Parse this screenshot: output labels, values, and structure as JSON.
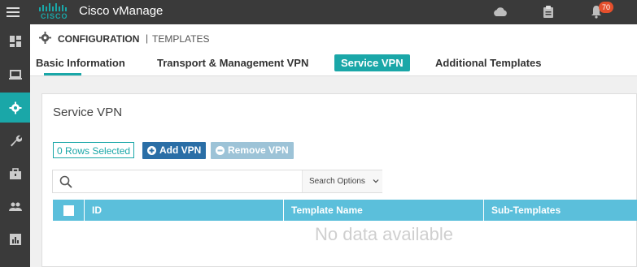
{
  "app": {
    "logo_text": "CISCO",
    "title": "Cisco vManage",
    "notification_count": "70"
  },
  "header": {
    "section": "CONFIGURATION",
    "separator": "|",
    "subsection": "TEMPLATES"
  },
  "tabs": [
    {
      "label": "Basic Information"
    },
    {
      "label": "Transport & Management VPN"
    },
    {
      "label": "Service VPN"
    },
    {
      "label": "Additional Templates"
    }
  ],
  "panel": {
    "title": "Service VPN",
    "rows_selected": "0 Rows Selected",
    "add_label": "Add VPN",
    "remove_label": "Remove VPN",
    "search_placeholder": "",
    "search_options": "Search Options",
    "columns": [
      "ID",
      "Template Name",
      "Sub-Templates"
    ],
    "empty_text": "No data available"
  },
  "sidebar": {
    "icons": [
      "dashboard-icon",
      "monitor-icon",
      "configuration-icon",
      "tools-icon",
      "maintenance-icon",
      "administration-icon",
      "analytics-icon"
    ]
  },
  "colors": {
    "accent": "#1aa7a8",
    "topbar": "#3a3a3a",
    "table_header": "#5bbfdb",
    "add_button": "#2a6ea6",
    "remove_button": "#9dc3d7",
    "badge": "#e54f2c"
  }
}
